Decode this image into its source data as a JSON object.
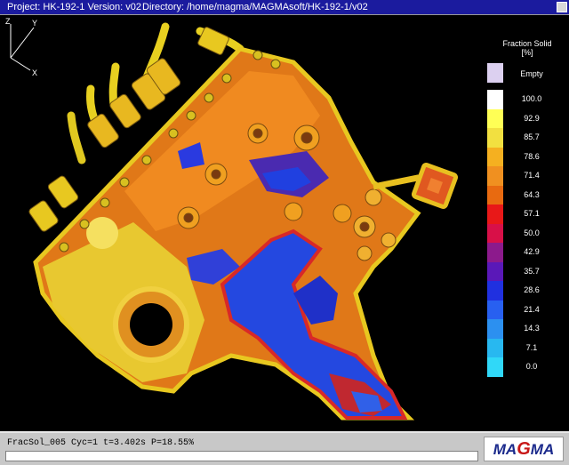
{
  "window": {
    "project_label": "Project: HK-192-1 Version: v02",
    "directory_label": "Directory: /home/magma/MAGMAsoft/HK-192-1/v02"
  },
  "legend": {
    "title": "Fraction Solid",
    "unit": "[%]",
    "empty_label": "Empty",
    "empty_color": "#dcd0f0",
    "items": [
      {
        "label": "100.0",
        "color": "#ffffff"
      },
      {
        "label": "92.9",
        "color": "#ffff55"
      },
      {
        "label": "85.7",
        "color": "#f2e040"
      },
      {
        "label": "78.6",
        "color": "#f5b020"
      },
      {
        "label": "71.4",
        "color": "#f09020"
      },
      {
        "label": "64.3",
        "color": "#e86a10"
      },
      {
        "label": "57.1",
        "color": "#e81818"
      },
      {
        "label": "50.0",
        "color": "#d81048"
      },
      {
        "label": "42.9",
        "color": "#8c1a8c"
      },
      {
        "label": "35.7",
        "color": "#5a18b8"
      },
      {
        "label": "28.6",
        "color": "#2030e0"
      },
      {
        "label": "21.4",
        "color": "#2860f0"
      },
      {
        "label": "14.3",
        "color": "#2c90f0"
      },
      {
        "label": "7.1",
        "color": "#28b8f0"
      },
      {
        "label": "0.0",
        "color": "#30d8f8"
      }
    ]
  },
  "axes": {
    "z": "Z",
    "y": "Y",
    "x": "X"
  },
  "status": {
    "text": "FracSol_005 Cyc=1 t=3.402s P=18.55%",
    "message": ""
  },
  "logo": {
    "part1": "MA",
    "part2": "G",
    "part3": "MA"
  }
}
